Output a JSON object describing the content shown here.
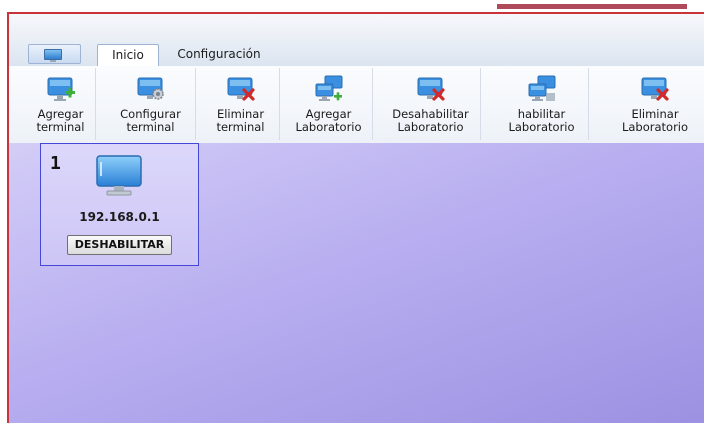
{
  "tabs": {
    "inicio": "Inicio",
    "configuracion": "Configuración"
  },
  "ribbon": {
    "agregar_terminal": "Agregar\nterminal",
    "configurar_terminal": "Configurar\nterminal",
    "eliminar_terminal": "Eliminar\nterminal",
    "agregar_laboratorio": "Agregar\nLaboratorio",
    "deshabilitar_laboratorio": "Desahabilitar\nLaboratorio",
    "habilitar_laboratorio": "habilitar\nLaboratorio",
    "eliminar_laboratorio": "Eliminar\nLaboratorio"
  },
  "terminal": {
    "number": "1",
    "ip": "192.168.0.1",
    "button_label": "DESHABILITAR"
  },
  "colors": {
    "accent_red": "#c8343a",
    "monitor_blue": "#3a8fe0",
    "card_border": "#4747d6"
  }
}
